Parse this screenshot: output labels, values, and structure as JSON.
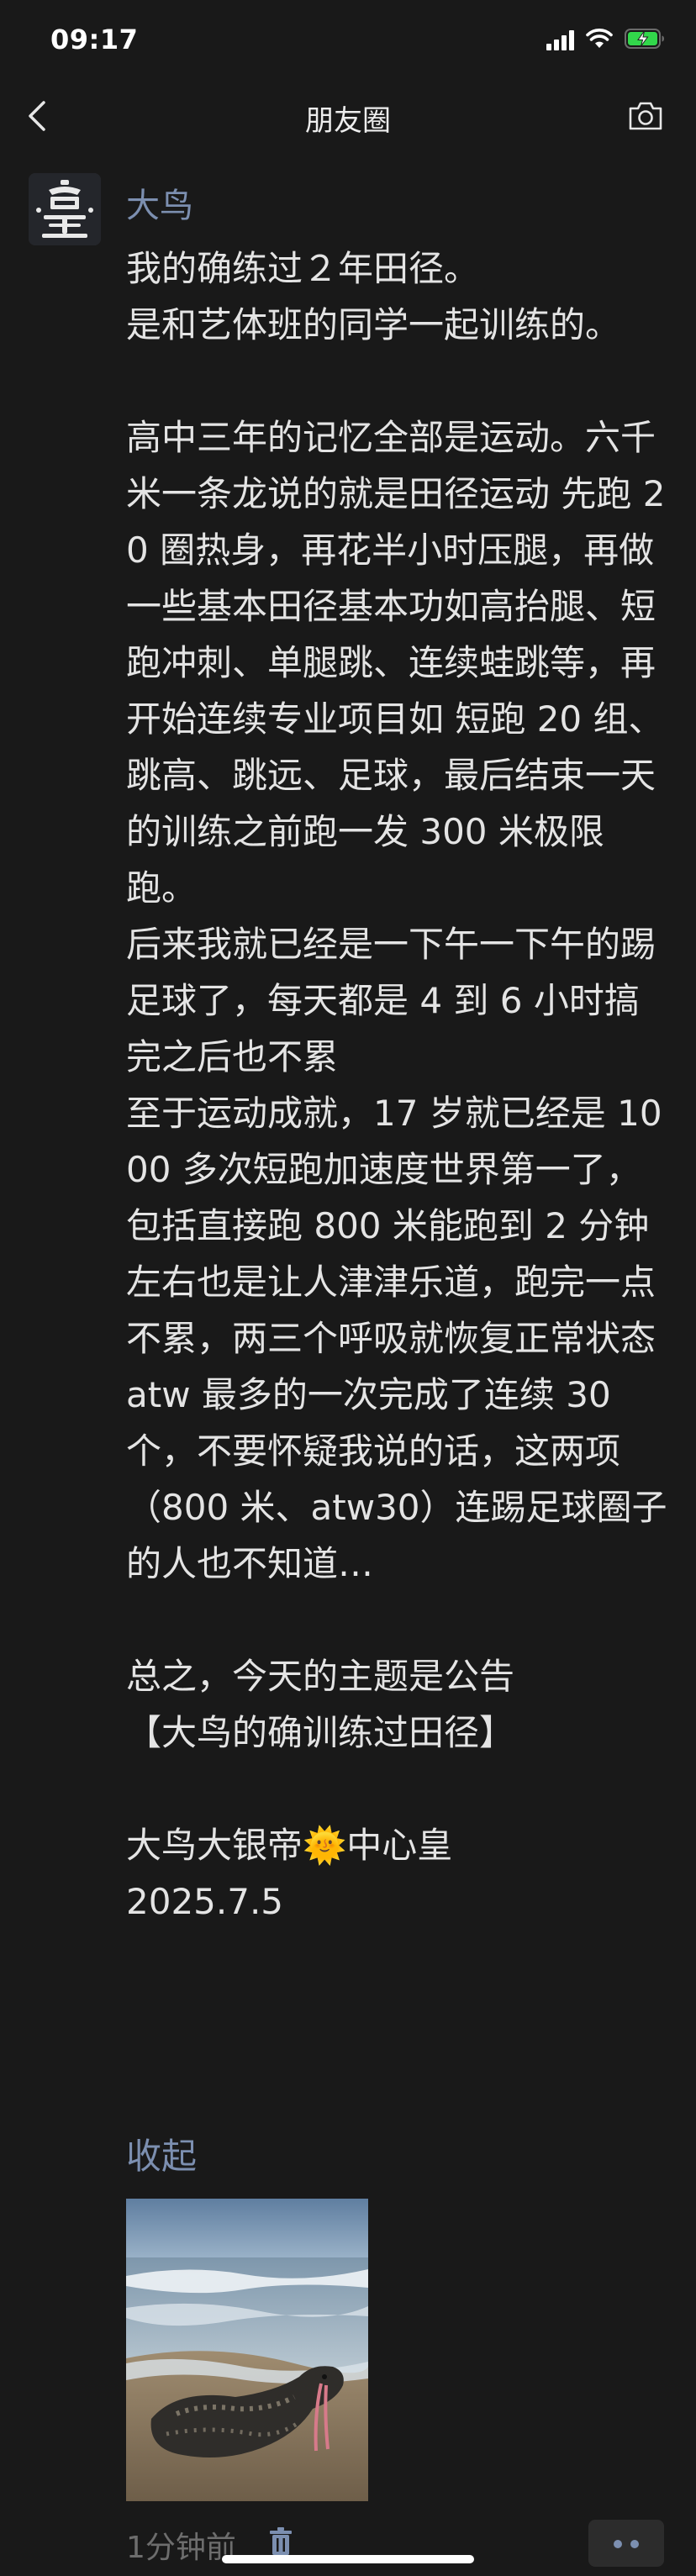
{
  "status_bar": {
    "time": "09:17",
    "icons": [
      "signal-icon",
      "wifi-icon",
      "battery-charging-icon"
    ],
    "battery_color": "#32d74b"
  },
  "nav": {
    "title": "朋友圈",
    "back_icon": "chevron-left-icon",
    "camera_icon": "camera-icon"
  },
  "post": {
    "author": "大鸟",
    "avatar_glyph": "皇",
    "body": "我的确练过２年田径。\n是和艺体班的同学一起训练的。\n\n高中三年的记忆全部是运动。六千米一条龙说的就是田径运动 先跑 20 圈热身，再花半小时压腿，再做一些基本田径基本功如高抬腿、短跑冲刺、单腿跳、连续蛙跳等，再开始连续专业项目如 短跑 20 组、跳高、跳远、足球，最后结束一天的训练之前跑一发 300 米极限跑。\n后来我就已经是一下午一下午的踢足球了，每天都是 4 到 6 小时搞完之后也不累\n至于运动成就，17 岁就已经是 1000 多次短跑加速度世界第一了，包括直接跑 800 米能跑到 2 分钟左右也是让人津津乐道，跑完一点不累，两三个呼吸就恢复正常状态\natw 最多的一次完成了连续 30 个，不要怀疑我说的话，这两项（800 米、atw30）连踢足球圈子的人也不知道…\n\n总之，今天的主题是公告\n【大鸟的确训练过田径】\n\n大鸟大银帝🌞中心皇\n2025.7.5",
    "collapse_label": "收起",
    "image_icon": "seal-photo",
    "time": "1分钟前",
    "trash_icon": "trash-icon",
    "more_icon": "more-dots-icon"
  },
  "colors": {
    "background": "#191919",
    "link": "#7c8fb0",
    "text": "#e4e4e4",
    "muted": "#6d6d6d"
  }
}
